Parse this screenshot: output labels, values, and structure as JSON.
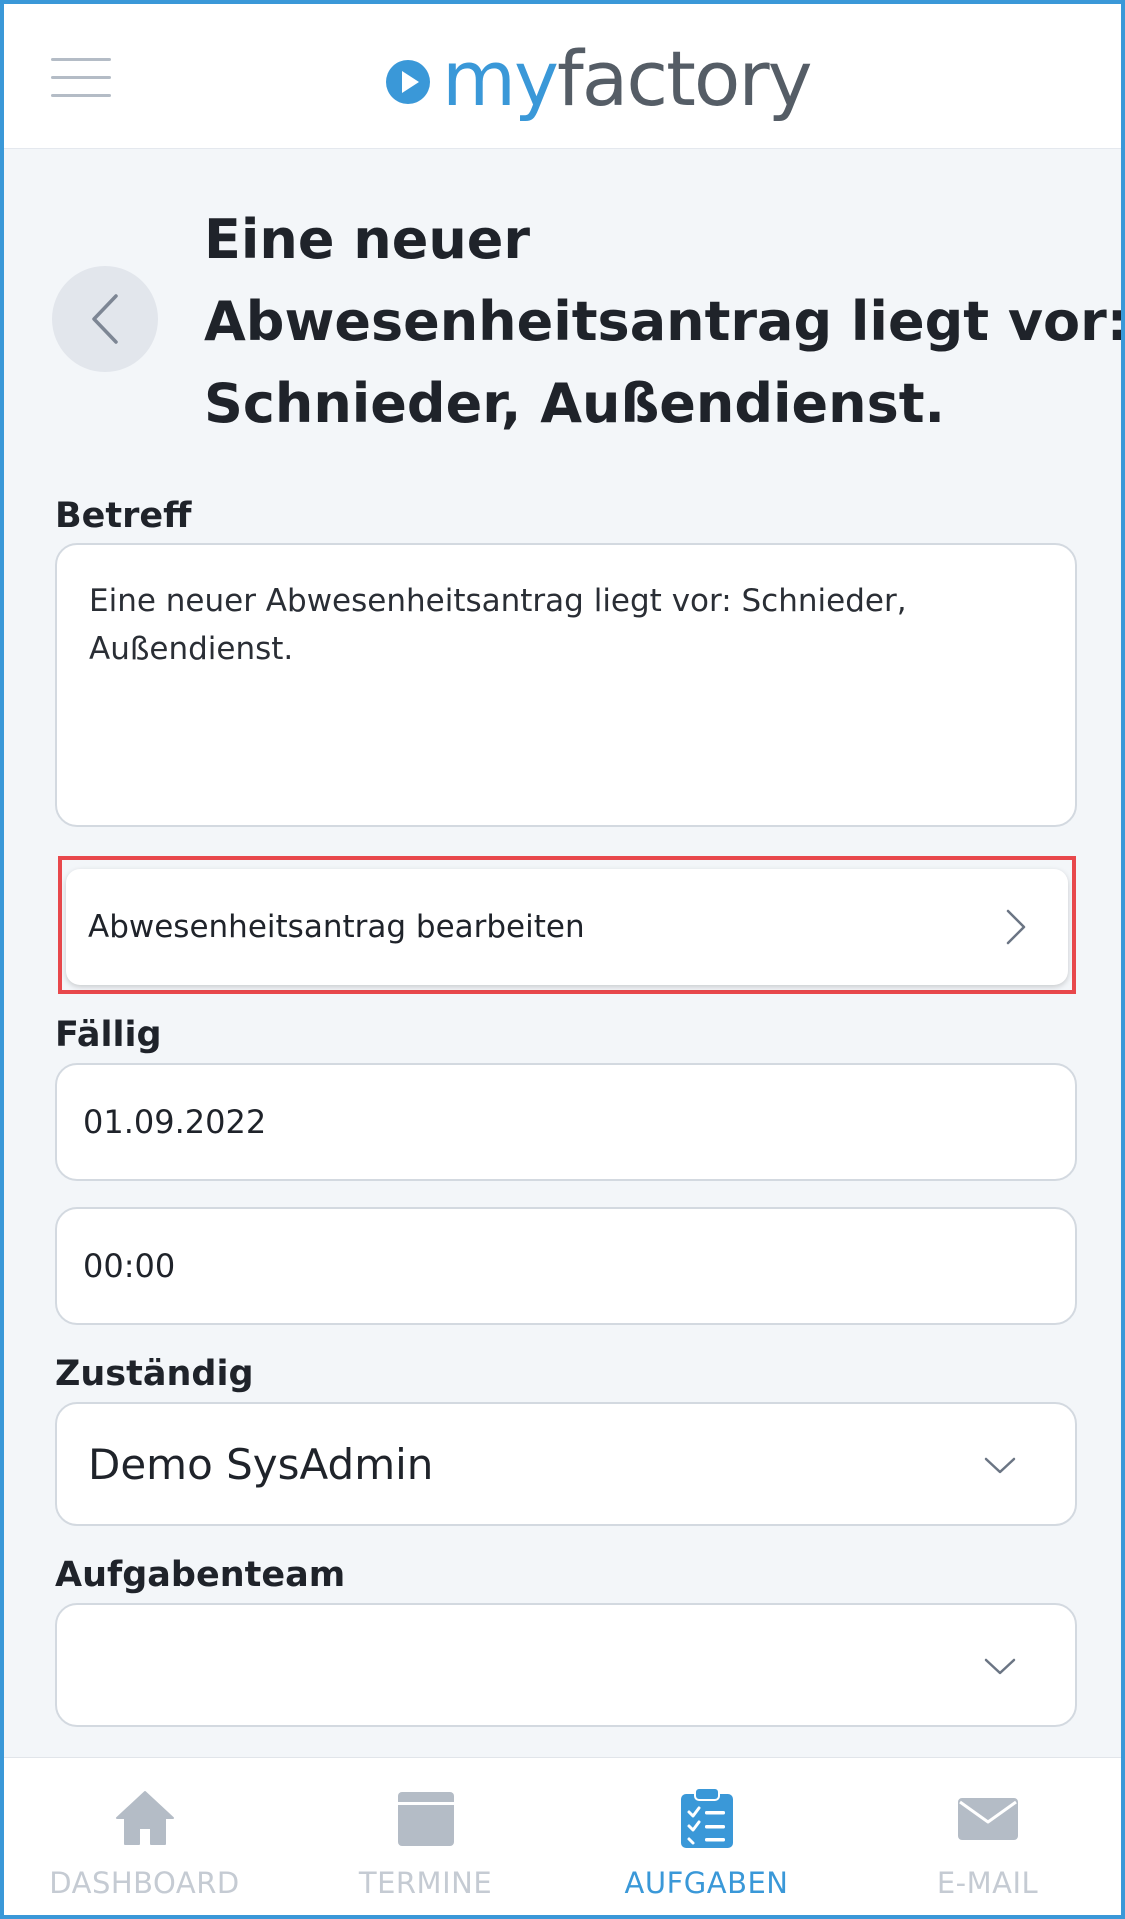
{
  "app": {
    "logo_my": "my",
    "logo_factory": "factory"
  },
  "page": {
    "title_lines": [
      "Eine neuer",
      "Abwesenheitsantrag liegt vor:",
      "Schnieder, Außendienst."
    ]
  },
  "form": {
    "subject_label": "Betreff",
    "subject_lines": [
      "Eine neuer Abwesenheitsantrag liegt vor: Schnieder,",
      "Außendienst."
    ],
    "action_label": "Abwesenheitsantrag bearbeiten",
    "due_label": "Fällig",
    "due_date": "01.09.2022",
    "due_time": "00:00",
    "responsible_label": "Zuständig",
    "responsible_value": "Demo SysAdmin",
    "team_label": "Aufgabenteam",
    "team_value": ""
  },
  "nav": {
    "items": [
      {
        "label": "DASHBOARD",
        "icon": "home-icon"
      },
      {
        "label": "TERMINE",
        "icon": "calendar-icon"
      },
      {
        "label": "AUFGABEN",
        "icon": "clipboard-check-icon",
        "active": true
      },
      {
        "label": "E-MAIL",
        "icon": "envelope-icon"
      }
    ]
  },
  "colors": {
    "brand_blue": "#3a98d8",
    "highlight_red": "#e8484c",
    "inactive_gray": "#b4bcc6"
  }
}
